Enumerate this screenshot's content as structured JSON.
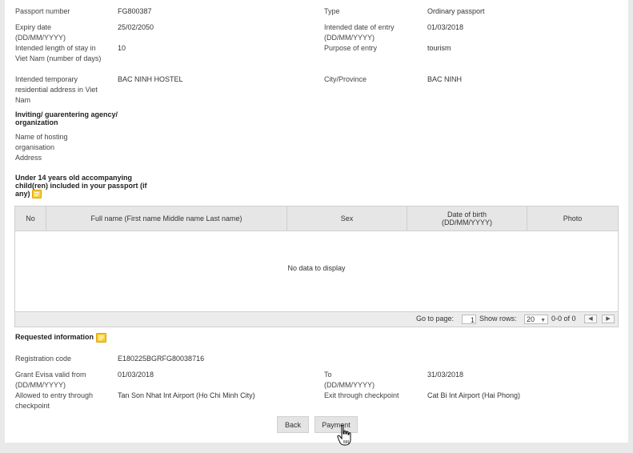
{
  "passport": {
    "number_label": "Passport number",
    "number_value": "FG800387",
    "type_label": "Type",
    "type_value": "Ordinary passport",
    "expiry_label": "Expiry date (DD/MM/YYYY)",
    "expiry_value": "25/02/2050",
    "entry_label": "Intended date of entry (DD/MM/YYYY)",
    "entry_value": "01/03/2018",
    "stay_label": "Intended length of stay in Viet Nam (number of days)",
    "stay_value": "10",
    "purpose_label": "Purpose of entry",
    "purpose_value": "tourism",
    "address_label": "Intended temporary residential address in Viet Nam",
    "address_value": "BAC NINH HOSTEL",
    "city_label": "City/Province",
    "city_value": "BAC NINH"
  },
  "agency": {
    "heading": "Inviting/ guarentering agency/ organization",
    "host_name_label": "Name of hosting organisation",
    "address_label": "Address"
  },
  "children": {
    "heading": "Under 14 years old accompanying child(ren) included in your passport (if any)",
    "columns": [
      "No",
      "Full name (First name Middle name Last name)",
      "Sex",
      "Date of birth (DD/MM/YYYY)",
      "Photo"
    ],
    "empty_text": "No data to display",
    "pager": {
      "goto_label": "Go to page:",
      "page_value": "1",
      "rows_label": "Show rows:",
      "rows_value": "20",
      "range_text": "0-0 of 0",
      "prev_symbol": "◀",
      "next_symbol": "▶",
      "dropdown_symbol": "▼"
    }
  },
  "requested": {
    "heading": "Requested information",
    "reg_label": "Registration code",
    "reg_value": "E180225BGRFG80038716",
    "valid_from_label": "Grant Evisa valid from (DD/MM/YYYY)",
    "valid_from_value": "01/03/2018",
    "to_label": "To (DD/MM/YYYY)",
    "to_value": "31/03/2018",
    "entry_cp_label": "Allowed to entry through checkpoint",
    "entry_cp_value": "Tan Son Nhat Int Airport (Ho Chi Minh City)",
    "exit_cp_label": "Exit through checkpoint",
    "exit_cp_value": "Cat Bi Int Airport (Hai Phong)"
  },
  "actions": {
    "back_label": "Back",
    "payment_label": "Payment"
  },
  "icons": {
    "note_icon": "note-icon",
    "cursor": "hand-cursor-icon",
    "accent": "#e8b010"
  }
}
